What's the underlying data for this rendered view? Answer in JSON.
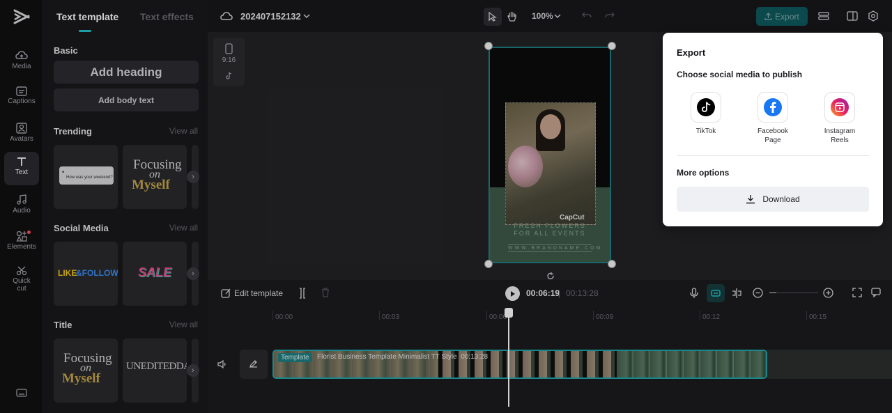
{
  "rail": {
    "items": [
      {
        "label": "Media",
        "icon": "media-icon"
      },
      {
        "label": "Captions",
        "icon": "captions-icon"
      },
      {
        "label": "Avatars",
        "icon": "avatars-icon"
      },
      {
        "label": "Text",
        "icon": "text-icon",
        "active": true
      },
      {
        "label": "Audio",
        "icon": "audio-icon"
      },
      {
        "label": "Elements",
        "icon": "elements-icon"
      },
      {
        "label": "Quick cut",
        "icon": "quick-cut-icon"
      }
    ]
  },
  "panel": {
    "tabs": [
      "Text template",
      "Text effects"
    ],
    "basic_title": "Basic",
    "add_heading": "Add heading",
    "add_body": "Add body text",
    "sections": [
      {
        "title": "Trending",
        "view_all": "View all"
      },
      {
        "title": "Social Media",
        "view_all": "View all"
      },
      {
        "title": "Title",
        "view_all": "View all"
      }
    ],
    "thumbs": {
      "bubble_line1": "•",
      "bubble_text": "How was your weekend?",
      "focusing1": "Focusing",
      "on1": "on",
      "myself1": "Myself",
      "like": "LIKE",
      "follow": "&FOLLOW",
      "sale": "SALE",
      "focusing2": "Focusing",
      "on2": "on",
      "myself2": "Myself",
      "unedited": "UNEDITEDDAY"
    }
  },
  "topbar": {
    "project_name": "202407152132",
    "zoom": "100%",
    "export_label": "Export"
  },
  "canvas": {
    "ratio_label": "9:16",
    "brand": "CapCut",
    "line1": "FRESH FLOWERS",
    "line2": "FOR ALL EVENTS",
    "url": "WWW.BRANDNAME.COM"
  },
  "timeline": {
    "edit_template": "Edit template",
    "current_time": "00:06:19",
    "separator": "|",
    "total_time": "00:13:28",
    "ruler": [
      "00:00",
      "00:03",
      "00:06",
      "00:09",
      "00:12",
      "00:15"
    ],
    "clip_tag": "Template",
    "clip_name": "Florist Business Template Minimalist TT Style",
    "clip_duration": "00:13:28"
  },
  "export_modal": {
    "title": "Export",
    "subtitle": "Choose social media to publish",
    "socials": [
      {
        "label": "TikTok",
        "icon": "tiktok-icon"
      },
      {
        "label": "Facebook Page",
        "icon": "facebook-icon"
      },
      {
        "label": "Instagram Reels",
        "icon": "instagram-icon"
      }
    ],
    "more_options": "More options",
    "download": "Download"
  },
  "colors": {
    "accent": "#22c3c9",
    "export_button": "#0e5a5e",
    "track_border": "#1ea6ab"
  }
}
